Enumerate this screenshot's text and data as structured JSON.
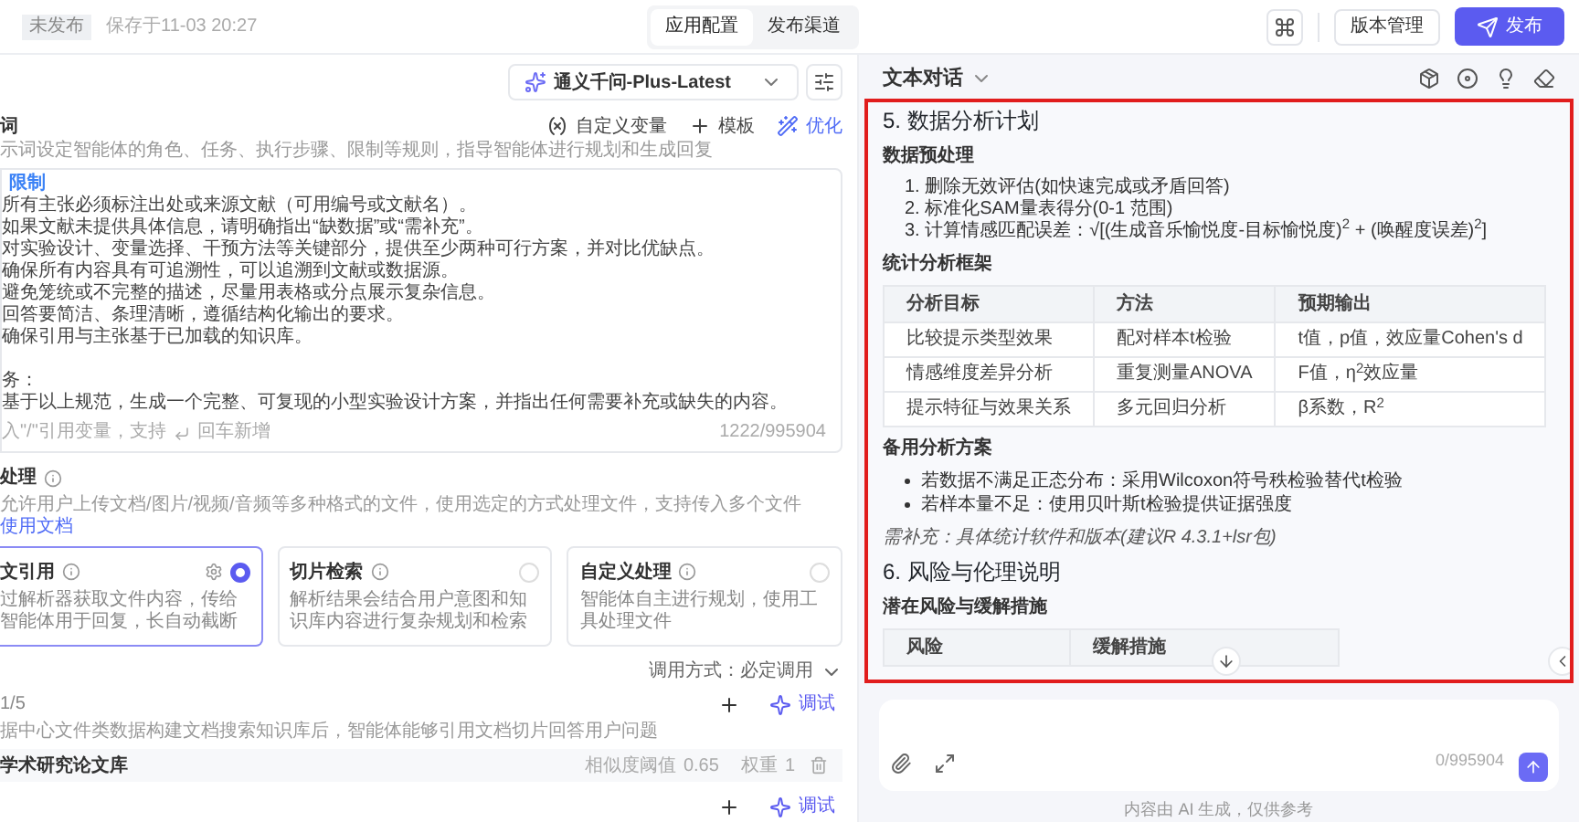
{
  "header": {
    "status_badge": "未发布",
    "saved_time": "保存于11-03 20:27",
    "tabs": [
      {
        "label": "应用配置",
        "selected": true
      },
      {
        "label": "发布渠道",
        "selected": false
      }
    ],
    "version_button": "版本管理",
    "publish_button": "发布"
  },
  "model": {
    "name": "通义千问-Plus-Latest"
  },
  "prompt": {
    "title": "词",
    "actions": [
      {
        "kind": "variable",
        "label": "自定义变量"
      },
      {
        "kind": "template",
        "label": "模板"
      },
      {
        "kind": "optimize",
        "label": "优化"
      }
    ],
    "description": "示词设定智能体的角色、任务、执行步骤、限制等规则，指导智能体进行规划和生成回复",
    "heading": "限制",
    "lines": [
      "所有主张必须标注出处或来源文献（可用编号或文献名）。",
      "如果文献未提供具体信息，请明确指出“缺数据”或“需补充”。",
      "对实验设计、变量选择、干预方法等关键部分，提供至少两种可行方案，并对比优缺点。",
      "确保所有内容具有可追溯性，可以追溯到文献或数据源。",
      "避免笼统或不完整的描述，尽量用表格或分点展示复杂信息。",
      "回答要简洁、条理清晰，遵循结构化输出的要求。",
      "确保引用与主张基于已加载的知识库。"
    ],
    "task_label": "务：",
    "task": "基于以上规范，生成一个完整、可复现的小型实验设计方案，并指出任何需要补充或缺失的内容。",
    "footer_hint": "入\"/\"引用变量，支持",
    "footer_hint_2": "回车新增",
    "counter": "1222/995904"
  },
  "file_processing": {
    "title": "处理",
    "description": "允许用户上传文档/图片/视频/音频等多种格式的文件，使用选定的方式处理文件，支持传入多个文件",
    "link": "使用文档",
    "options": [
      {
        "title": "文引用",
        "description": "过解析器获取文件内容，传给智能体用于回复，长自动截断",
        "selected": true,
        "settings": true
      },
      {
        "title": "切片检索",
        "description": "解析结果会结合用户意图和知识库内容进行复杂规划和检索",
        "selected": false,
        "settings": false
      },
      {
        "title": "自定义处理",
        "description": "智能体自主进行规划，使用工具处理文件",
        "selected": false,
        "settings": false
      }
    ],
    "call_mode": "调用方式：必定调用"
  },
  "knowledge": {
    "count": "1/5",
    "debug": "调试",
    "description": "据中心文件类数据构建文档搜索知识库后，智能体能够引用文档切片回答用户问题",
    "items": [
      {
        "name": "学术研究论文库",
        "threshold_label": "相似度阈值",
        "threshold": "0.65",
        "weight_label": "权重",
        "weight": "1"
      }
    ]
  },
  "next_section": {
    "debug": "调试"
  },
  "chat": {
    "mode": "文本对话",
    "blocks": [
      {
        "kind": "heading",
        "text": "5. 数据分析计划"
      },
      {
        "kind": "subheading",
        "text": "数据预处理"
      },
      {
        "kind": "ordered_list",
        "items": [
          "1. 删除无效评估(如快速完成或矛盾回答)",
          "2. 标准化SAM量表得分(0-1 范围)",
          "3. 计算情感匹配误差：√[(生成音乐愉悦度-目标愉悦度)$^{2}$ + (唤醒度误差)$^{2}$]"
        ]
      },
      {
        "kind": "subheading",
        "text": "统计分析框架"
      },
      {
        "kind": "table",
        "columns": [
          "分析目标",
          "方法",
          "预期输出"
        ],
        "rows": [
          [
            "比较提示类型效果",
            "配对样本t检验",
            "t值，p值，效应量Cohen's d"
          ],
          [
            "情感维度差异分析",
            "重复测量ANOVA",
            "F值，η$^{2}$效应量"
          ],
          [
            "提示特征与效果关系",
            "多元回归分析",
            "β系数，R$^{2}$"
          ]
        ]
      },
      {
        "kind": "subheading",
        "text": "备用分析方案"
      },
      {
        "kind": "bullet_list",
        "items": [
          "若数据不满足正态分布：采用Wilcoxon符号秩检验替代t检验",
          "若样本量不足：使用贝叶斯t检验提供证据强度"
        ]
      },
      {
        "kind": "note",
        "text": "需补充：具体统计软件和版本(建议R 4.3.1+lsr包)"
      },
      {
        "kind": "heading",
        "text": "6. 风险与伦理说明"
      },
      {
        "kind": "subheading",
        "text": "潜在风险与缓解措施"
      },
      {
        "kind": "table",
        "columns": [
          "风险",
          "缓解措施"
        ]
      }
    ]
  },
  "input": {
    "counter": "0/995904"
  },
  "disclaimer": "内容由 AI 生成，仅供参考"
}
